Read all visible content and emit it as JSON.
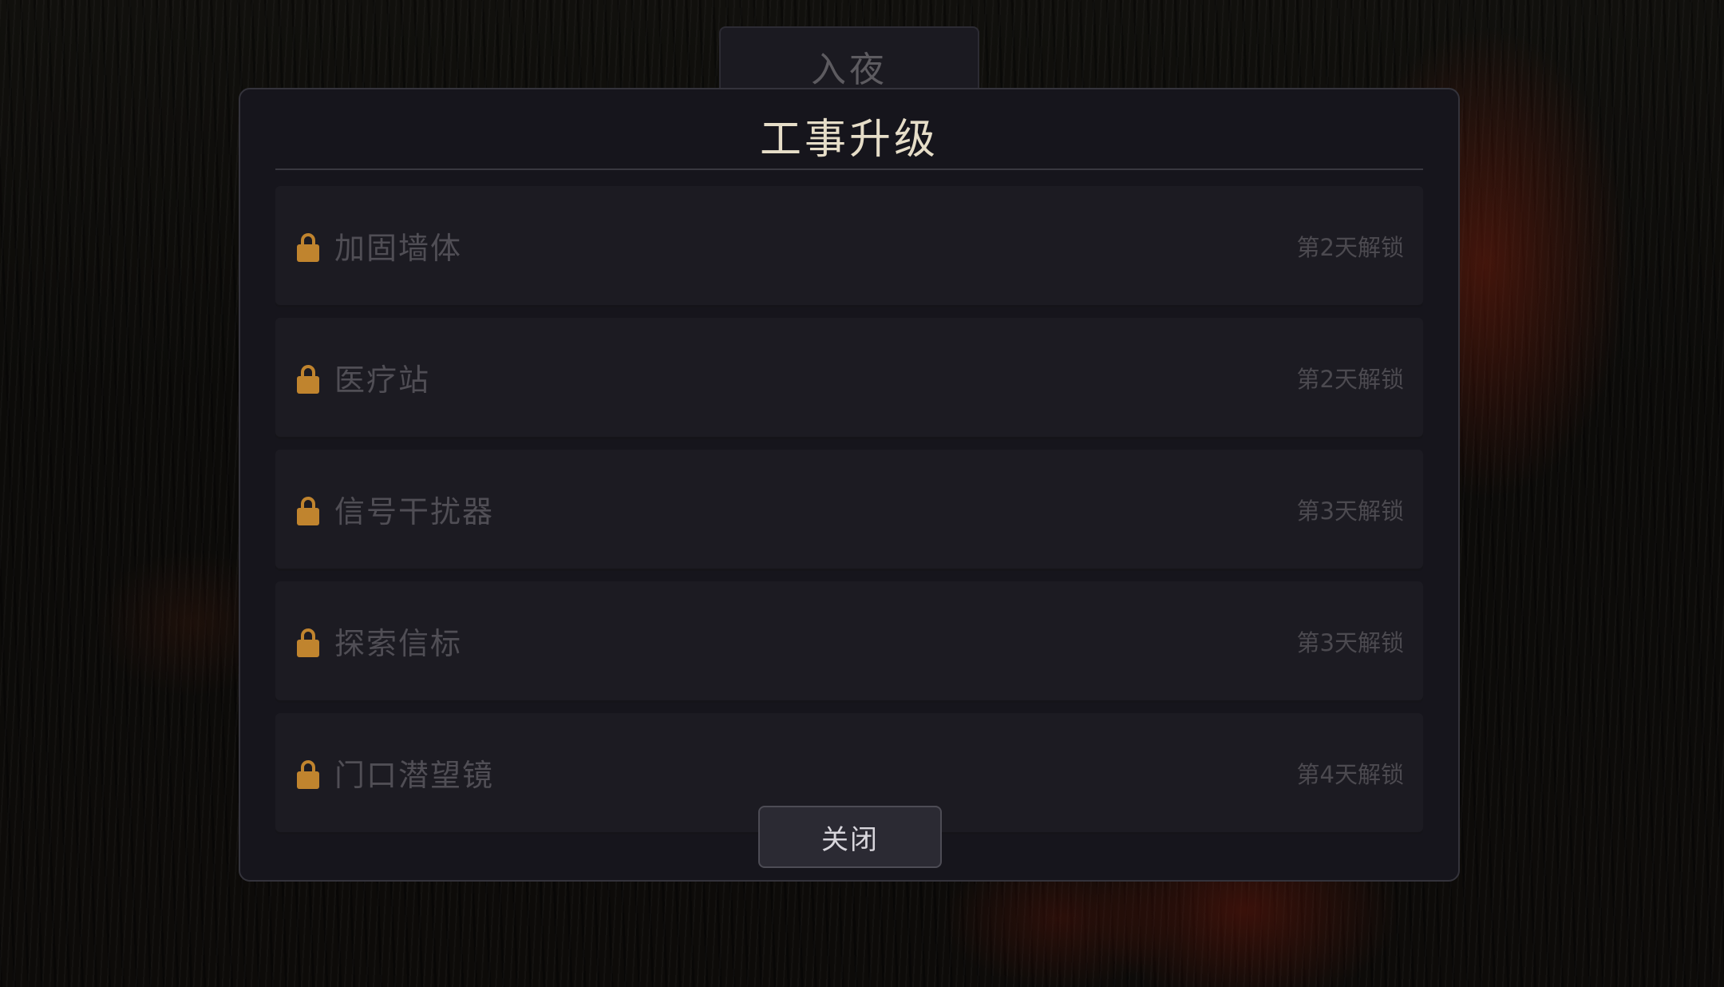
{
  "top_tab": {
    "label": "入夜"
  },
  "panel": {
    "title": "工事升级",
    "items": [
      {
        "name": "加固墙体",
        "status": "第2天解锁",
        "locked": true
      },
      {
        "name": "医疗站",
        "status": "第2天解锁",
        "locked": true
      },
      {
        "name": "信号干扰器",
        "status": "第3天解锁",
        "locked": true
      },
      {
        "name": "探索信标",
        "status": "第3天解锁",
        "locked": true
      },
      {
        "name": "门口潜望镜",
        "status": "第4天解锁",
        "locked": true
      }
    ],
    "close_label": "关闭"
  },
  "colors": {
    "accent_lock": "#c0842e",
    "title_text": "#e6ddc8",
    "panel_bg": "#16151c"
  },
  "icons": {
    "lock": "lock-icon"
  }
}
